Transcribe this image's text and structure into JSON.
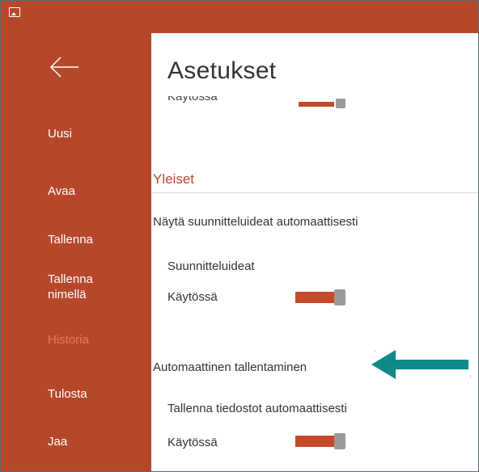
{
  "titlebar": {
    "app_icon": "image-icon"
  },
  "sidebar": {
    "back_icon": "back-arrow-icon",
    "items": [
      {
        "label": "Uusi",
        "active": false
      },
      {
        "label": "Avaa",
        "active": false
      },
      {
        "label": "Tallenna",
        "active": false
      },
      {
        "label": "Tallenna\nnimellä",
        "active": false
      },
      {
        "label": "Historia",
        "active": true
      },
      {
        "label": "Tulosta",
        "active": false
      },
      {
        "label": "Jaa",
        "active": false
      }
    ]
  },
  "main": {
    "title": "Asetukset",
    "cut_row_label": "Käytössä",
    "section_title": "Yleiset",
    "design_ideas": {
      "header": "Näytä suunnitteluideat automaattisesti",
      "label": "Suunnitteluideat",
      "toggle_label": "Käytössä",
      "enabled": true
    },
    "autosave": {
      "header": "Automaattinen tallentaminen",
      "label": "Tallenna tiedostot automaattisesti",
      "toggle_label": "Käytössä",
      "enabled": true
    }
  },
  "colors": {
    "brand": "#b7472a",
    "active_nav": "#e07a5f",
    "callout_arrow": "#0e8a8a",
    "toggle_knob": "#9a9a9a"
  }
}
